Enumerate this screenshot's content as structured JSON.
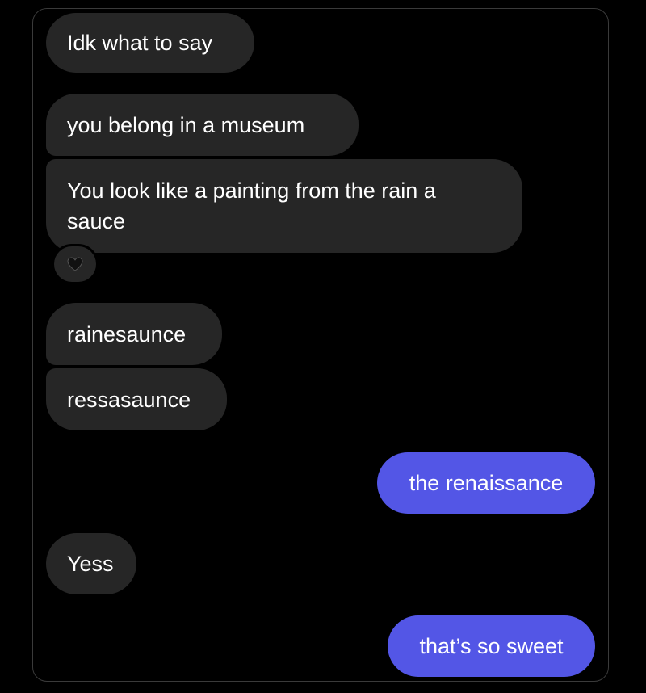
{
  "messages": [
    {
      "text": "Idk what to say",
      "direction": "received"
    },
    {
      "text": "you belong in a museum",
      "direction": "received"
    },
    {
      "text": "You look like a painting from the rain a sauce",
      "direction": "received"
    },
    {
      "text": "rainesaunce",
      "direction": "received"
    },
    {
      "text": "ressasaunce",
      "direction": "received"
    },
    {
      "text": "the renaissance",
      "direction": "sent"
    },
    {
      "text": "Yess",
      "direction": "received"
    },
    {
      "text": "that’s so sweet",
      "direction": "sent"
    }
  ],
  "reaction": {
    "icon": "black-heart-icon",
    "color": "#111111"
  },
  "colors": {
    "background": "#000000",
    "received_bubble": "#262626",
    "sent_bubble": "#5356e6",
    "text": "#ffffff"
  }
}
